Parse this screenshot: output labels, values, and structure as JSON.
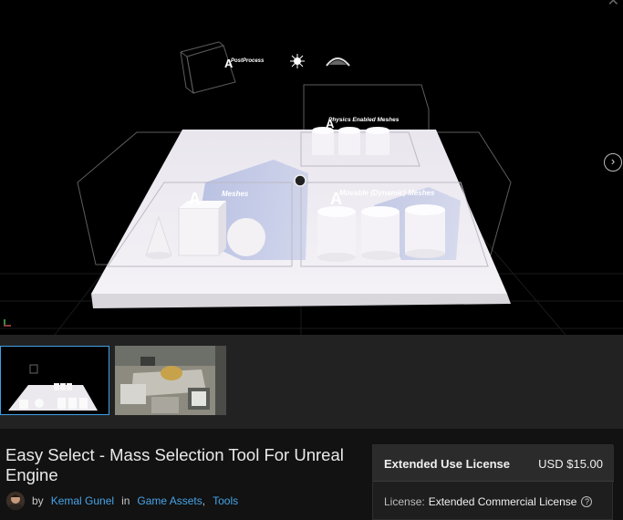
{
  "viewer": {
    "close_icon": "close-icon",
    "next_icon": "chevron-right-icon",
    "scene_labels": {
      "postprocess": "PostProcess",
      "physics": "Physics Enabled Meshes",
      "static": "Meshes",
      "movable": "Movable (Dynamic) Meshes"
    }
  },
  "thumbnails": [
    {
      "name": "level-overview",
      "selected": true
    },
    {
      "name": "office-scene",
      "selected": false
    }
  ],
  "product": {
    "title": "Easy Select - Mass Selection Tool For Unreal Engine",
    "by": "by",
    "author": "Kemal Gunel",
    "in": "in",
    "category": "Game Assets",
    "category_sep": ",",
    "subcategory": "Tools"
  },
  "license": {
    "name": "Extended Use License",
    "price": "USD $15.00",
    "label": "License:",
    "value": "Extended Commercial License",
    "help_icon": "help-icon"
  },
  "colors": {
    "accent": "#47a3e8",
    "selected_border": "#3ea0e6",
    "panel": "#2b2b2b"
  }
}
